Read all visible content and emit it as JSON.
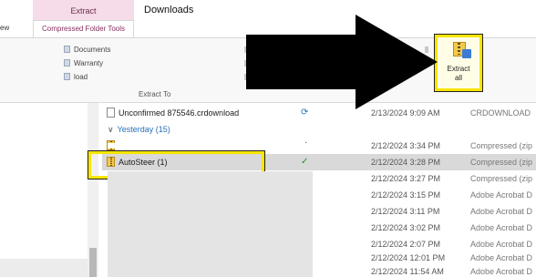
{
  "window": {
    "title": "Downloads",
    "context_tab_group": "Extract",
    "tabs": [
      {
        "label": "ew"
      },
      {
        "label": "Compressed Folder Tools"
      }
    ]
  },
  "ribbon": {
    "extract_to_locations": [
      {
        "label": "Documents"
      },
      {
        "label": "Warranty"
      },
      {
        "label": "load"
      }
    ],
    "group_label": "Extract To",
    "extract_all_label": "Extract\nall"
  },
  "file_list": {
    "top_row": {
      "name": "Unconfirmed 875546.crdownload",
      "date": "2/13/2024 9:09 AM",
      "type": "CRDOWNLOAD",
      "status_icon": "sync-icon"
    },
    "group_header": "Yesterday (15)",
    "rows": [
      {
        "name": "",
        "date": "2/12/2024 3:34 PM",
        "type": "Compressed (zip",
        "status": "✓",
        "icon": "zip"
      },
      {
        "name": "AutoSteer (1)",
        "date": "2/12/2024 3:28 PM",
        "type": "Compressed (zip",
        "status": "✓",
        "icon": "zip"
      },
      {
        "name": "",
        "date": "2/12/2024 3:27 PM",
        "type": "Compressed (zip",
        "status": "",
        "icon": ""
      },
      {
        "name": "",
        "date": "2/12/2024 3:15 PM",
        "type": "Adobe Acrobat D",
        "status": "",
        "icon": ""
      },
      {
        "name": "",
        "date": "2/12/2024 3:11 PM",
        "type": "Adobe Acrobat D",
        "status": "",
        "icon": ""
      },
      {
        "name": "",
        "date": "2/12/2024 3:02 PM",
        "type": "Adobe Acrobat D",
        "status": "",
        "icon": ""
      },
      {
        "name": "",
        "date": "2/12/2024 2:07 PM",
        "type": "Adobe Acrobat D",
        "status": "",
        "icon": ""
      },
      {
        "name": "",
        "date": "2/12/2024 12:01 PM",
        "type": "Adobe Acrobat D",
        "status": "",
        "icon": ""
      },
      {
        "name": "",
        "date": "2/12/2024 11:54 AM",
        "type": "Adobe Acrobat D",
        "status": "",
        "icon": ""
      }
    ]
  },
  "colors": {
    "highlight": "#f6e500",
    "context_tab": "#f6dbe9",
    "selected_row": "#d9d9d9",
    "group_header": "#2a6fb8"
  }
}
